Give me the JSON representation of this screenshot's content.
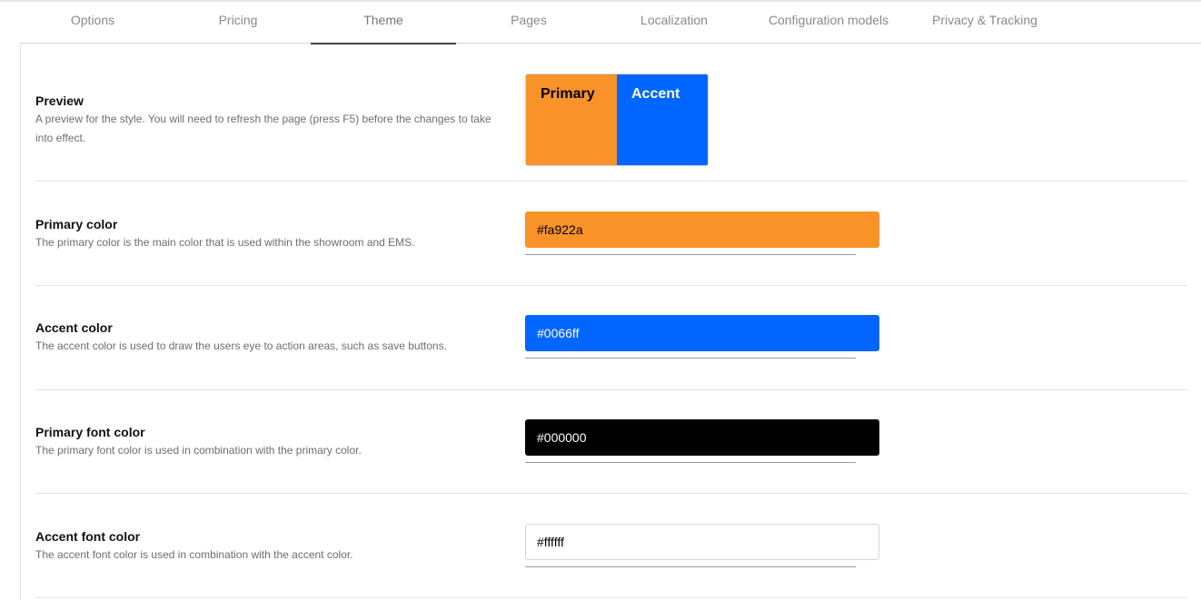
{
  "tabs": [
    {
      "label": "Options",
      "active": false
    },
    {
      "label": "Pricing",
      "active": false
    },
    {
      "label": "Theme",
      "active": true
    },
    {
      "label": "Pages",
      "active": false
    },
    {
      "label": "Localization",
      "active": false
    },
    {
      "label": "Configuration models",
      "active": false
    },
    {
      "label": "Privacy & Tracking",
      "active": false
    }
  ],
  "preview": {
    "title": "Preview",
    "description": "A preview for the style. You will need to refresh the page (press F5) before the changes to take into effect.",
    "primary_label": "Primary",
    "accent_label": "Accent"
  },
  "settings": {
    "primary_color": {
      "title": "Primary color",
      "description": "The primary color is the main color that is used within the showroom and EMS.",
      "value": "#fa922a"
    },
    "accent_color": {
      "title": "Accent color",
      "description": "The accent color is used to draw the users eye to action areas, such as save buttons.",
      "value": "#0066ff"
    },
    "primary_font_color": {
      "title": "Primary font color",
      "description": "The primary font color is used in combination with the primary color.",
      "value": "#000000"
    },
    "accent_font_color": {
      "title": "Accent font color",
      "description": "The accent font color is used in combination with the accent color.",
      "value": "#ffffff"
    }
  },
  "colors": {
    "primary": "#fa922a",
    "accent": "#0066ff",
    "primary_font": "#000000",
    "accent_font": "#ffffff"
  }
}
